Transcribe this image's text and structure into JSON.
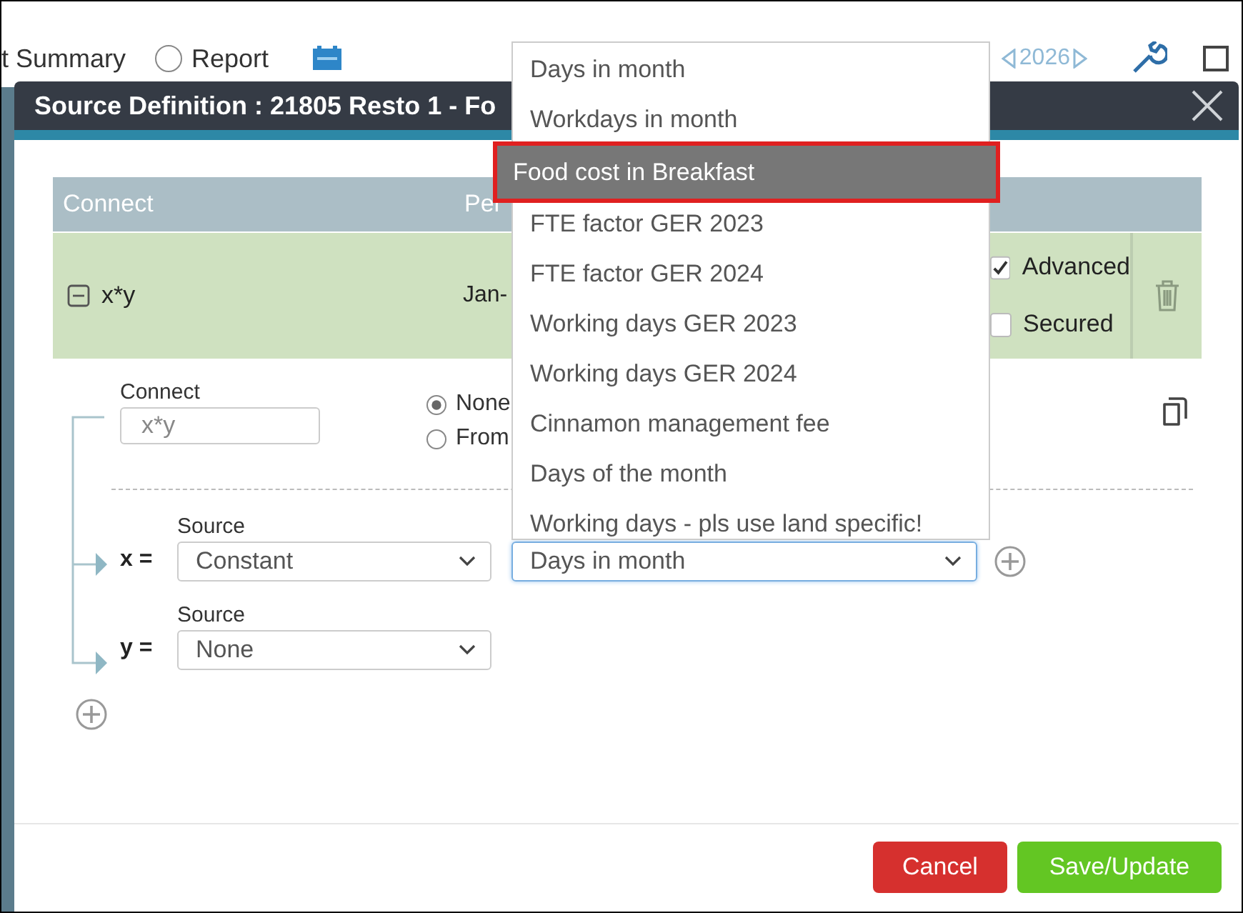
{
  "background_toolbar": {
    "summary_label": "t Summary",
    "report_option": {
      "label": "Report",
      "selected": false
    },
    "year": "2026"
  },
  "dialog": {
    "title": "Source Definition : 21805 Resto 1 - Fo",
    "table": {
      "columns": [
        "Connect",
        "Per"
      ],
      "row": {
        "expanded": true,
        "formula": "x*y",
        "period": "Jan-",
        "options": [
          {
            "label": "Advanced",
            "checked": true
          },
          {
            "label": "Secured",
            "checked": false
          }
        ]
      }
    },
    "editor": {
      "connect_label": "Connect",
      "connect_value": "x*y",
      "modes": [
        {
          "label": "None",
          "selected": true
        },
        {
          "label": "From",
          "selected": false
        }
      ],
      "variables": [
        {
          "name": "x =",
          "source_label": "Source",
          "source": "Constant",
          "value": "Days in month"
        },
        {
          "name": "y =",
          "source_label": "Source",
          "source": "None"
        }
      ]
    },
    "buttons": [
      {
        "label": "Cancel",
        "kind": "cancel"
      },
      {
        "label": "Save/Update",
        "kind": "save"
      }
    ]
  },
  "dropdown": {
    "options": [
      {
        "label": "Days in month",
        "selected": false
      },
      {
        "label": "Workdays in month",
        "selected": false
      },
      {
        "label": "Food cost in Breakfast",
        "selected": true
      },
      {
        "label": "FTE factor GER 2023",
        "selected": false
      },
      {
        "label": "FTE factor GER 2024",
        "selected": false
      },
      {
        "label": "Working days GER 2023",
        "selected": false
      },
      {
        "label": "Working days GER 2024",
        "selected": false
      },
      {
        "label": "Cinnamon management fee",
        "selected": false
      },
      {
        "label": "Days of the month",
        "selected": false
      },
      {
        "label": "Working days - pls use land specific!",
        "selected": false
      }
    ]
  }
}
